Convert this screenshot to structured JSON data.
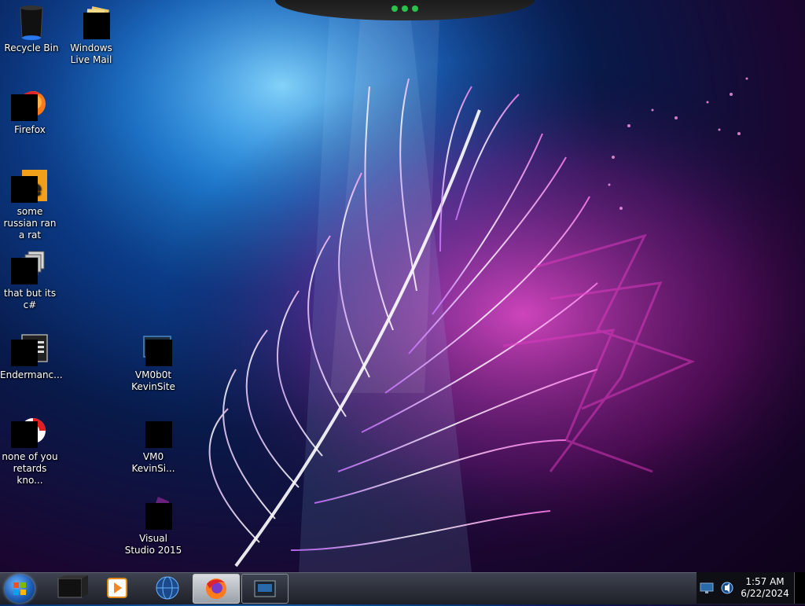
{
  "desktop": {
    "icons": [
      {
        "name": "recycle-bin",
        "label": "Recycle Bin"
      },
      {
        "name": "windows-live-mail",
        "label": "Windows Live Mail"
      },
      {
        "name": "firefox",
        "label": "Firefox"
      },
      {
        "name": "some-russian-ran-a-rat",
        "label": "some russian ran a rat"
      },
      {
        "name": "that-but-its-csharp",
        "label": "that but its c#"
      },
      {
        "name": "endermanc",
        "label": "Endermanc..."
      },
      {
        "name": "none-of-you",
        "label": "none of you retards kno..."
      },
      {
        "name": "vm0b0t-kevinsite",
        "label": "VM0b0t KevinSite"
      },
      {
        "name": "vm0-kevinsi",
        "label": "VM0 KevinSi..."
      },
      {
        "name": "visual-studio-2015",
        "label": "Visual Studio 2015"
      }
    ]
  },
  "taskbar": {
    "apps": [
      {
        "name": "taskbar-app-terminal-icon"
      },
      {
        "name": "taskbar-app-media-player-icon"
      },
      {
        "name": "taskbar-app-globe-icon"
      },
      {
        "name": "taskbar-app-firefox-icon"
      },
      {
        "name": "taskbar-app-window-icon"
      }
    ],
    "tray": {
      "time": "1:57 AM",
      "date": "6/22/2024"
    }
  },
  "colors": {
    "accent_green": "#29c24a",
    "taskbar_bg": "#2a2d36"
  }
}
